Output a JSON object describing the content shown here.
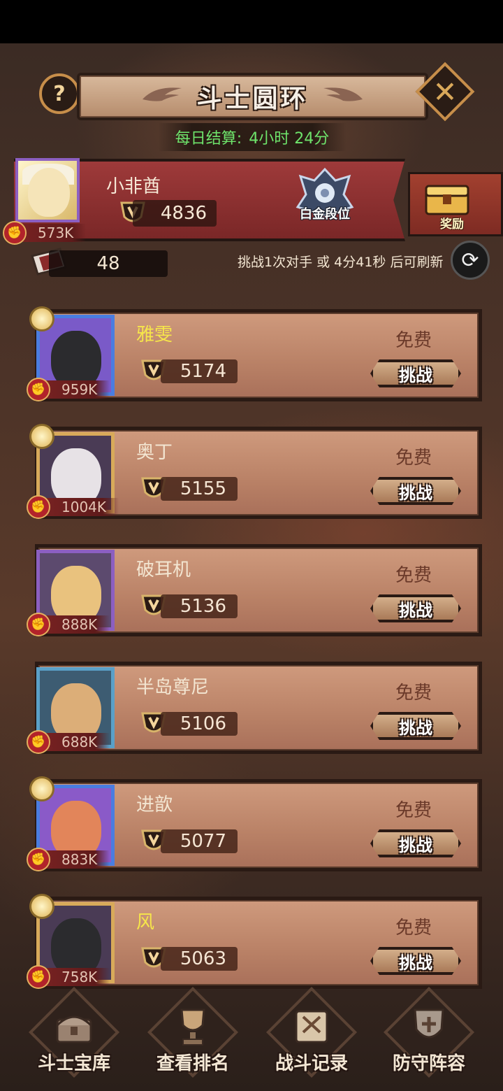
{
  "header": {
    "title": "斗士圆环",
    "help_icon_label": "?",
    "close_icon_label": "✕"
  },
  "daily": {
    "label": "每日结算:",
    "time": "4小时 24分"
  },
  "player": {
    "name": "小非酋",
    "score": "4836",
    "power": "573K",
    "rank_label": "白金段位",
    "reward_label": "奖励",
    "tickets": "48"
  },
  "refresh": {
    "text": "挑战1次对手 或 4分41秒 后可刷新",
    "icon": "refresh-icon"
  },
  "opponents": [
    {
      "name": "雅雯",
      "score": "5174",
      "power": "959K",
      "cost": "免费",
      "button": "挑战",
      "name_color": "#f6e64a",
      "frame": "#4a7de0",
      "bg": "#7a5ac8",
      "head": "#2b2b2e",
      "medal": true
    },
    {
      "name": "奥丁",
      "score": "5155",
      "power": "1004K",
      "cost": "免费",
      "button": "挑战",
      "name_color": "#f3e6d2",
      "frame": "#d8aa5a",
      "bg": "#4a3b55",
      "head": "#e7e2e6",
      "medal": true
    },
    {
      "name": "破耳机",
      "score": "5136",
      "power": "888K",
      "cost": "免费",
      "button": "挑战",
      "name_color": "#f3e6d2",
      "frame": "#8c5fc1",
      "bg": "#5c4a6e",
      "head": "#e9c27e",
      "medal": false
    },
    {
      "name": "半岛尊尼",
      "score": "5106",
      "power": "688K",
      "cost": "免费",
      "button": "挑战",
      "name_color": "#f3e6d2",
      "frame": "#5aa0c8",
      "bg": "#3d5c72",
      "head": "#dcae78",
      "medal": false
    },
    {
      "name": "进歆",
      "score": "5077",
      "power": "883K",
      "cost": "免费",
      "button": "挑战",
      "name_color": "#f3e6d2",
      "frame": "#4a7de0",
      "bg": "#8a5ac8",
      "head": "#e2855a",
      "medal": true
    },
    {
      "name": "风",
      "score": "5063",
      "power": "758K",
      "cost": "免费",
      "button": "挑战",
      "name_color": "#f6e64a",
      "frame": "#d8aa5a",
      "bg": "#4a3b55",
      "head": "#2b2b2e",
      "medal": true
    }
  ],
  "nav": [
    {
      "label": "斗士宝库",
      "icon": "treasure-chest-icon"
    },
    {
      "label": "查看排名",
      "icon": "trophy-cup-icon"
    },
    {
      "label": "战斗记录",
      "icon": "battle-scroll-icon"
    },
    {
      "label": "防守阵容",
      "icon": "defense-shield-icon"
    }
  ]
}
